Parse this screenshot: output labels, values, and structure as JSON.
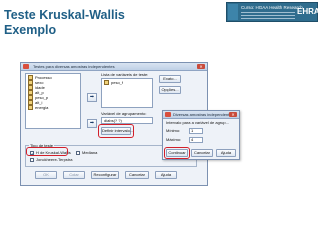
{
  "slide": {
    "title_line1": "Teste Kruskal-Wallis",
    "title_line2": "Exemplo"
  },
  "banner": {
    "course_text": "Curso: HGAA Health Research",
    "logo_text": "EHRA"
  },
  "main_dialog": {
    "title": "Testes para diversas amostras independentes",
    "variables": [
      "Processo",
      "sexo",
      "idade",
      "alt_p",
      "peso_p",
      "alt_i",
      "energia"
    ],
    "test_list_label": "Lista de variáveis de teste:",
    "test_list_items": [
      "peso_f"
    ],
    "grouping_label": "Variável de agrupamento:",
    "grouping_value": "diabs(? ?)",
    "define_interval_button": "Definir intervalo...",
    "exact_button": "Exato...",
    "options_button": "Opções...",
    "test_type_group": "Tipo de teste",
    "tests": [
      {
        "label": "H de Kruskal-Wallis",
        "checked": true
      },
      {
        "label": "Mediana",
        "checked": false
      },
      {
        "label": "Jonckheere-Terpstra",
        "checked": false
      }
    ],
    "buttons": [
      "OK",
      "Colar",
      "Reconfigurar",
      "Cancelar",
      "Ajuda"
    ]
  },
  "sub_dialog": {
    "title": "Diversas amostras independente...",
    "range_label": "Intervalo para a variável de agrup...",
    "min_label": "Mínimo:",
    "min_value": "1",
    "max_label": "Máximo:",
    "max_value": "4",
    "buttons": [
      "Continuar",
      "Cancelar",
      "Ajuda"
    ]
  },
  "colors": {
    "title_blue": "#1f5f86",
    "highlight_red": "#d21f2a",
    "dialog_bg": "#eef2f8"
  }
}
